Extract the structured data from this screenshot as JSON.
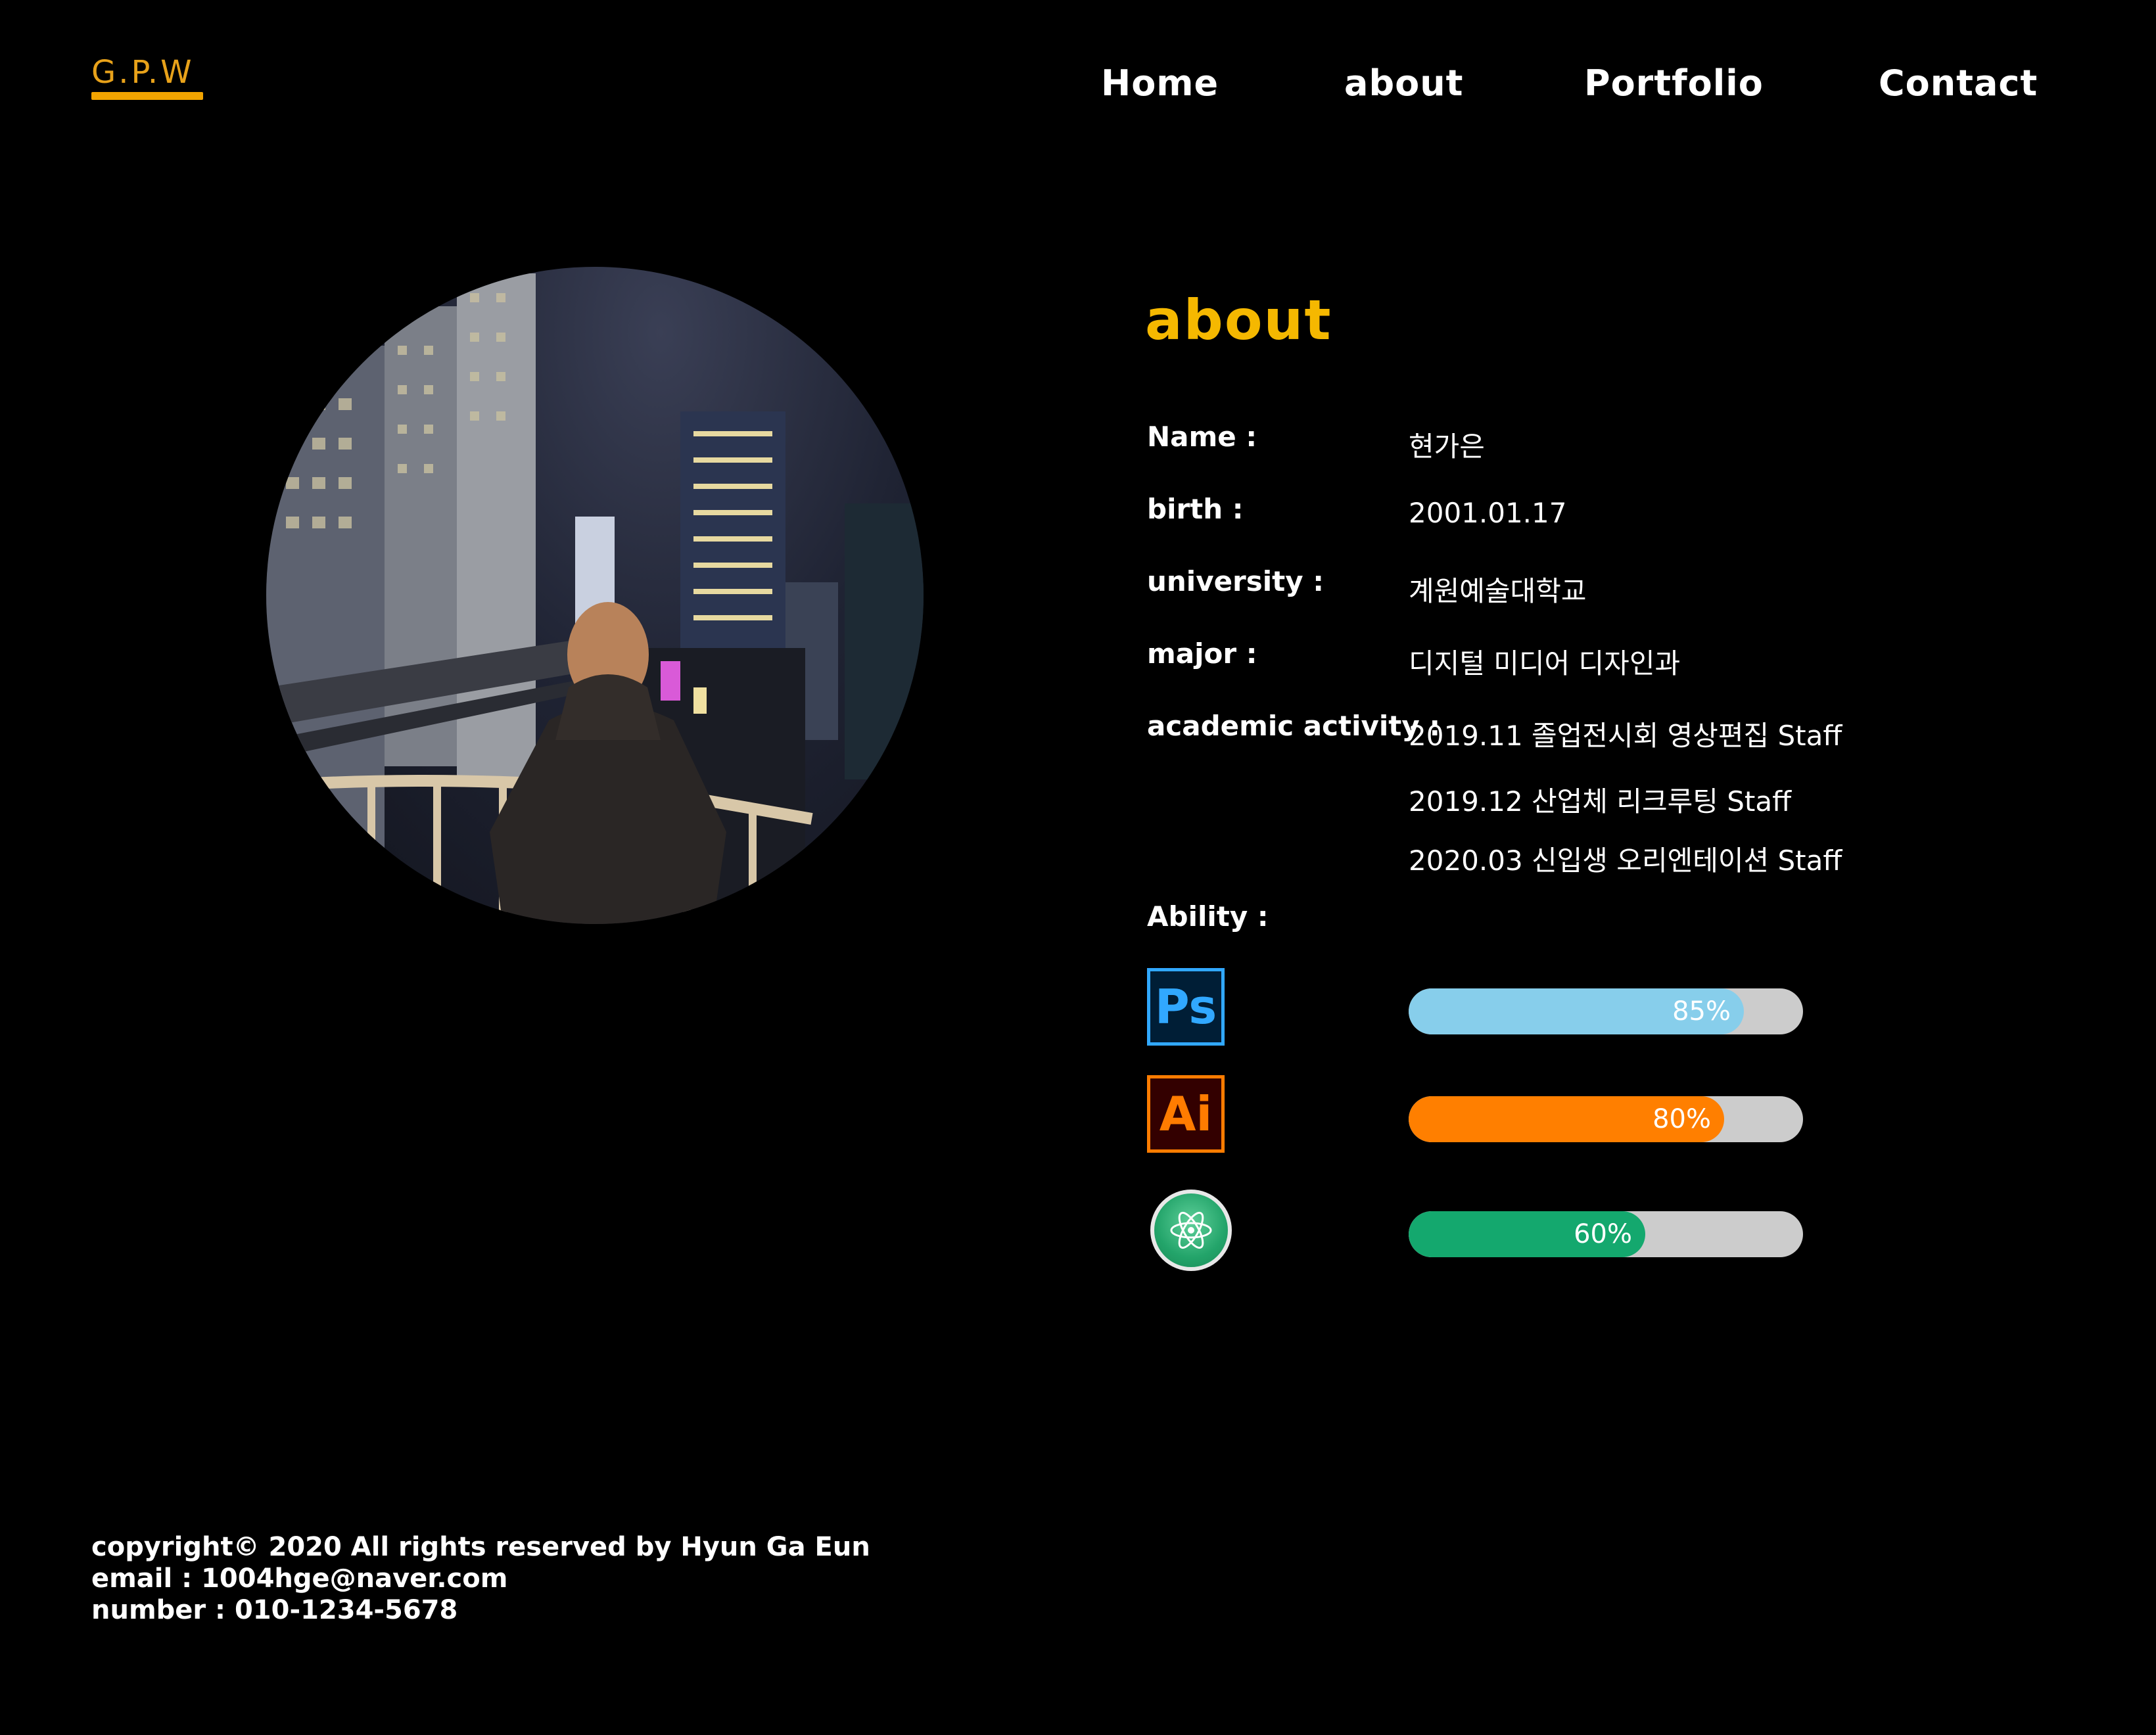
{
  "logo": {
    "text": "G.P.W"
  },
  "nav": {
    "items": [
      "Home",
      "about",
      "Portfolio",
      "Contact"
    ]
  },
  "about": {
    "title": "about",
    "rows": [
      {
        "label": "Name :",
        "value": "현가은"
      },
      {
        "label": "birth :",
        "value": "2001.01.17"
      },
      {
        "label": "university :",
        "value": "계원예술대학교"
      },
      {
        "label": "major :",
        "value": "디지털 미디어 디자인과"
      },
      {
        "label": "academic activity :",
        "value": "2019.11 졸업전시회 영상편집 Staff"
      }
    ],
    "activities_more": [
      "2019.12 산업체 리크루팅 Staff",
      "2020.03 신입생 오리엔테이션 Staff"
    ],
    "ability_label": "Ability :"
  },
  "skills": [
    {
      "icon": "photoshop-icon",
      "icon_text": "Ps",
      "percent": 85,
      "percent_label": "85%",
      "color": "#87ceeb"
    },
    {
      "icon": "illustrator-icon",
      "icon_text": "Ai",
      "percent": 80,
      "percent_label": "80%",
      "color": "#ff7f00"
    },
    {
      "icon": "atom-icon",
      "icon_text": "",
      "percent": 60,
      "percent_label": "60%",
      "color": "#14a86e"
    }
  ],
  "footer": {
    "copyright": "copyright© 2020 All rights reserved by Hyun Ga Eun",
    "email": "email : 1004hge@naver.com",
    "number": "number : 010-1234-5678"
  }
}
